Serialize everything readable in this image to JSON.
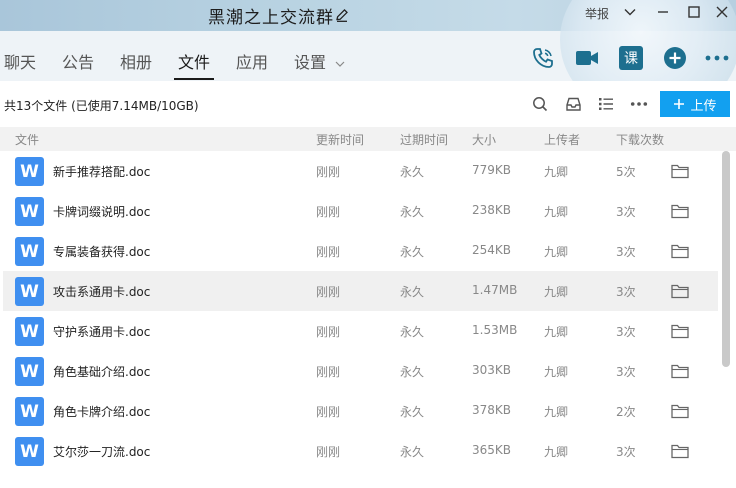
{
  "window": {
    "title": "黑潮之上交流群",
    "report_label": "举报"
  },
  "nav": {
    "tabs": [
      {
        "label": "聊天"
      },
      {
        "label": "公告"
      },
      {
        "label": "相册"
      },
      {
        "label": "文件"
      },
      {
        "label": "应用"
      },
      {
        "label": "设置"
      }
    ],
    "active_tab": "文件",
    "course_label": "课"
  },
  "toolbar": {
    "summary": "共13个文件 (已使用7.14MB/10GB)",
    "upload_label": "上传"
  },
  "table": {
    "headers": {
      "file": "文件",
      "updated": "更新时间",
      "expiry": "过期时间",
      "size": "大小",
      "uploader": "上传者",
      "downloads": "下载次数"
    },
    "rows": [
      {
        "name": "新手推荐搭配.doc",
        "updated": "刚刚",
        "expiry": "永久",
        "size": "779KB",
        "uploader": "九卿",
        "downloads": "5次"
      },
      {
        "name": "卡牌词缀说明.doc",
        "updated": "刚刚",
        "expiry": "永久",
        "size": "238KB",
        "uploader": "九卿",
        "downloads": "3次"
      },
      {
        "name": "专属装备获得.doc",
        "updated": "刚刚",
        "expiry": "永久",
        "size": "254KB",
        "uploader": "九卿",
        "downloads": "3次"
      },
      {
        "name": "攻击系通用卡.doc",
        "updated": "刚刚",
        "expiry": "永久",
        "size": "1.47MB",
        "uploader": "九卿",
        "downloads": "3次"
      },
      {
        "name": "守护系通用卡.doc",
        "updated": "刚刚",
        "expiry": "永久",
        "size": "1.53MB",
        "uploader": "九卿",
        "downloads": "3次"
      },
      {
        "name": "角色基础介绍.doc",
        "updated": "刚刚",
        "expiry": "永久",
        "size": "303KB",
        "uploader": "九卿",
        "downloads": "3次"
      },
      {
        "name": "角色卡牌介绍.doc",
        "updated": "刚刚",
        "expiry": "永久",
        "size": "378KB",
        "uploader": "九卿",
        "downloads": "2次"
      },
      {
        "name": "艾尔莎一刀流.doc",
        "updated": "刚刚",
        "expiry": "永久",
        "size": "365KB",
        "uploader": "九卿",
        "downloads": "3次"
      }
    ],
    "file_icon_letter": "W"
  },
  "colors": {
    "accent": "#12a0f0",
    "word_icon": "#3f8ff0",
    "nav_icon": "#1d6f8f"
  }
}
